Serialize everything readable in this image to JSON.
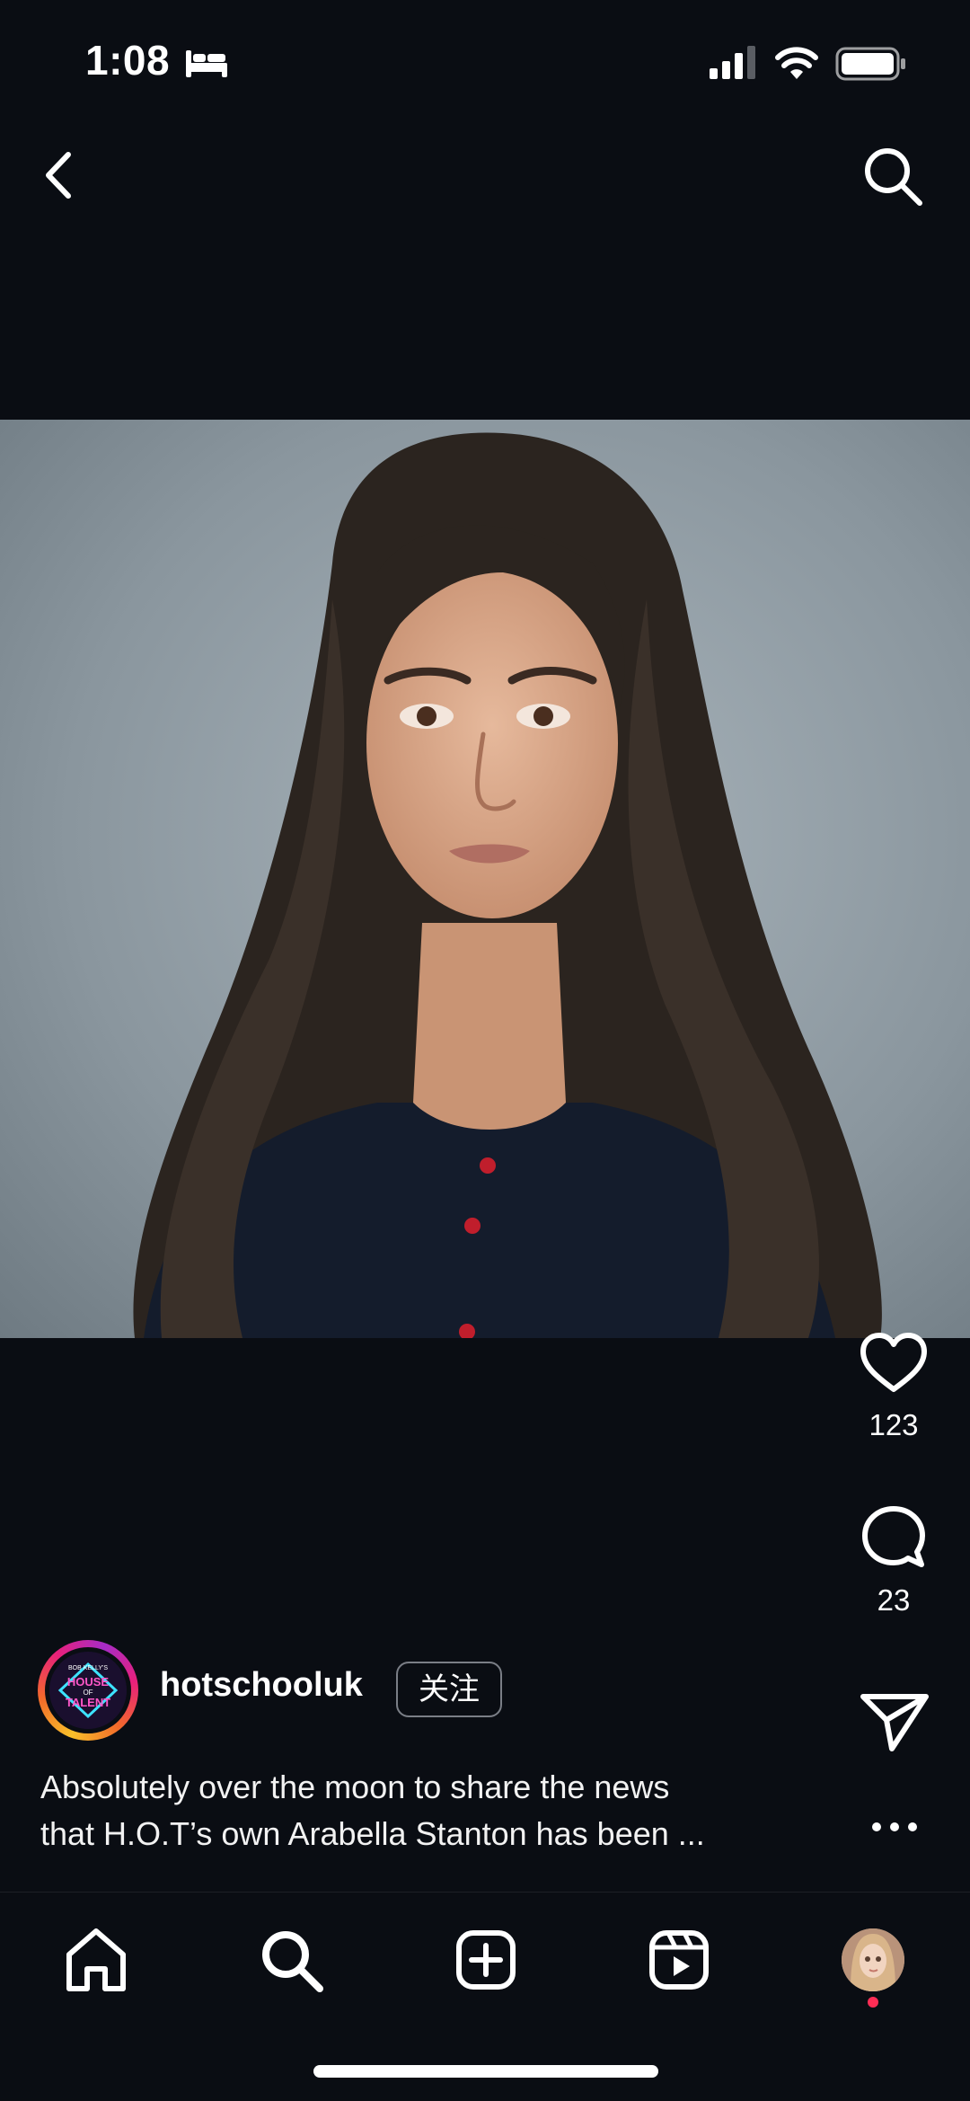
{
  "status_bar": {
    "time": "1:08",
    "icons": [
      "sleep-icon",
      "cellular-signal-icon",
      "wifi-icon",
      "battery-icon"
    ]
  },
  "top_nav": {
    "back_icon": "chevron-left-icon",
    "search_icon": "search-icon"
  },
  "post": {
    "image_alt": "portrait photo",
    "likes": "123",
    "comments": "23",
    "author": {
      "username": "hotschooluk",
      "avatar_logo_lines": [
        "BOB KELLY'S",
        "HOUSE",
        "OF",
        "TALENT"
      ],
      "follow_label": "关注"
    },
    "caption_lines": [
      "Absolutely over the moon to share the news",
      "that H.O.T’s own Arabella Stanton has been ..."
    ]
  },
  "bottom_nav": {
    "items": [
      "home-icon",
      "search-icon",
      "create-icon",
      "reels-icon",
      "profile-avatar"
    ]
  },
  "colors": {
    "background": "#0a0d13",
    "text": "#ffffff",
    "notification_dot": "#ff2d55"
  }
}
